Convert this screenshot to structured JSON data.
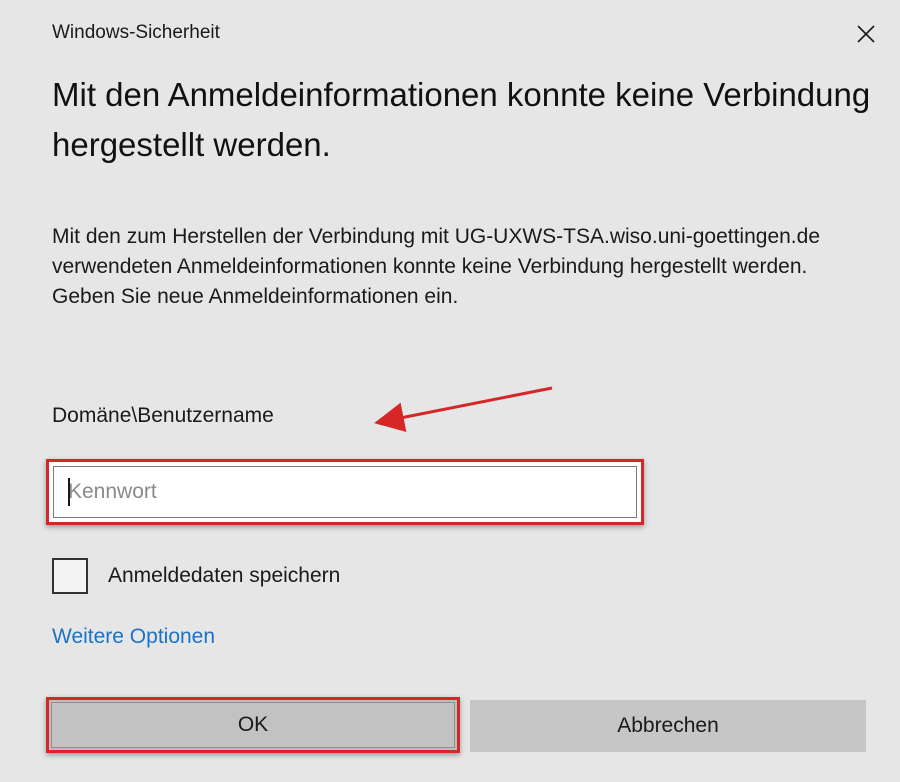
{
  "window": {
    "title": "Windows-Sicherheit",
    "close_icon": "close-icon"
  },
  "heading": "Mit den Anmeldeinformationen konnte keine Verbindung hergestellt werden.",
  "message": "Mit den zum Herstellen der Verbindung mit UG-UXWS-TSA.wiso.uni-goettingen.de verwendeten Anmeldeinformationen konnte keine Verbindung hergestellt werden. Geben Sie neue Anmeldeinformationen ein.",
  "username": "Domäne\\Benutzername",
  "password": {
    "value": "",
    "placeholder": "Kennwort"
  },
  "remember": {
    "label": "Anmeldedaten speichern",
    "checked": false
  },
  "more_options": "Weitere Optionen",
  "buttons": {
    "ok": "OK",
    "cancel": "Abbrechen"
  },
  "colors": {
    "background": "#e6e6e6",
    "link": "#1a73c8",
    "annotation": "#d62727",
    "button": "#c6c6c6"
  }
}
